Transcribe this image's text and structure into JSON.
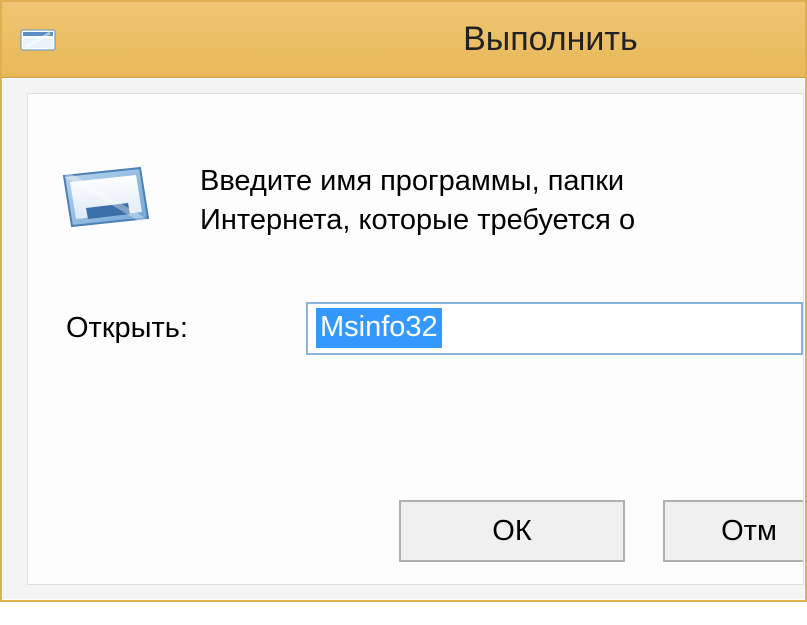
{
  "titlebar": {
    "title": "Выполнить"
  },
  "body": {
    "description_line1": "Введите имя программы, папки",
    "description_line2": "Интернета, которые требуется о",
    "open_label": "Открыть:",
    "open_value": "Msinfo32"
  },
  "buttons": {
    "ok": "ОК",
    "cancel": "Отм"
  }
}
